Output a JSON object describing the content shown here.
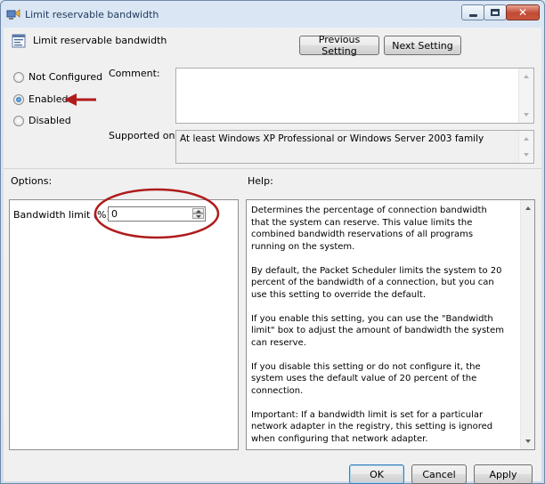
{
  "window": {
    "title": "Limit reservable bandwidth"
  },
  "header": {
    "title": "Limit reservable bandwidth",
    "previous_label": "Previous Setting",
    "next_label": "Next Setting"
  },
  "state": {
    "options": [
      {
        "label": "Not Configured",
        "checked": false
      },
      {
        "label": "Enabled",
        "checked": true
      },
      {
        "label": "Disabled",
        "checked": false
      }
    ],
    "comment_label": "Comment:",
    "comment_value": "",
    "supported_label": "Supported on:",
    "supported_value": "At least Windows XP Professional or Windows Server 2003 family"
  },
  "options_panel": {
    "heading": "Options:",
    "bandwidth_label": "Bandwidth limit (%):",
    "bandwidth_value": "0"
  },
  "help_panel": {
    "heading": "Help:",
    "paragraphs": [
      "Determines the percentage of connection bandwidth that the system can reserve. This value limits the combined bandwidth reservations of all programs running on the system.",
      "By default, the Packet Scheduler limits the system to 20 percent of the bandwidth of a connection, but you can use this setting to override the default.",
      "If you enable this setting, you can use the \"Bandwidth limit\" box to adjust the amount of bandwidth the system can reserve.",
      "If you disable this setting or do not configure it, the system uses the default value of 20 percent of the connection.",
      "Important: If a bandwidth limit is set for a particular network adapter in the registry, this setting is ignored when configuring that network adapter."
    ]
  },
  "footer": {
    "ok_label": "OK",
    "cancel_label": "Cancel",
    "apply_label": "Apply"
  },
  "icons": {
    "window_icon": "network-policy-icon",
    "header_icon": "policy-setting-icon"
  },
  "colors": {
    "annotation": "#b01c1c",
    "dialog_bg": "#f0f0f0",
    "titlebar": "#dbe6f4"
  }
}
